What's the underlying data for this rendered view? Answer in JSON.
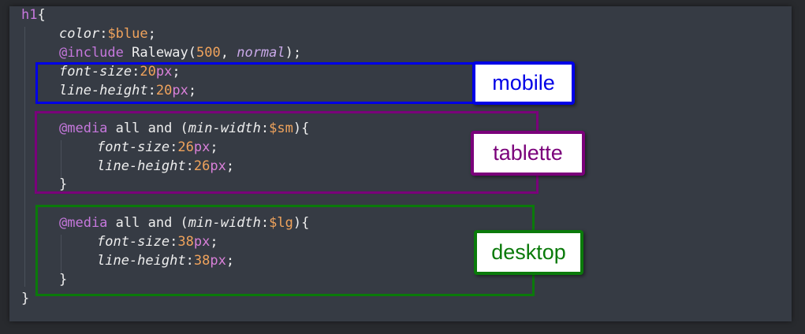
{
  "code": {
    "selector": "h1",
    "open_brace": "{",
    "close_brace": "}",
    "colon": ":",
    "semicolon": ";",
    "color_prop": "color",
    "color_value": "$blue",
    "include_at": "@include",
    "include_name": " Raleway(",
    "include_weight": "500",
    "include_sep": ", ",
    "include_style": "normal",
    "include_close": ");",
    "mobile": {
      "font_size_prop": "font-size",
      "font_size_num": "20",
      "line_height_prop": "line-height",
      "line_height_num": "20"
    },
    "tablet": {
      "media_at": "@media",
      "media_text": " all and (",
      "media_feature": "min-width",
      "media_var": "$sm",
      "media_close": "){",
      "font_size_prop": "font-size",
      "font_size_num": "26",
      "line_height_prop": "line-height",
      "line_height_num": "26",
      "close": "}"
    },
    "desktop": {
      "media_at": "@media",
      "media_text": " all and (",
      "media_feature": "min-width",
      "media_var": "$lg",
      "media_close": "){",
      "font_size_prop": "font-size",
      "font_size_num": "38",
      "line_height_prop": "line-height",
      "line_height_num": "38",
      "close": "}"
    },
    "unit": "px"
  },
  "annotations": {
    "mobile_label": "mobile",
    "tablet_label": "tablette",
    "desktop_label": "desktop"
  },
  "colors": {
    "mobile": "#0000e6",
    "tablet": "#7a007a",
    "desktop": "#0a7a0a"
  }
}
